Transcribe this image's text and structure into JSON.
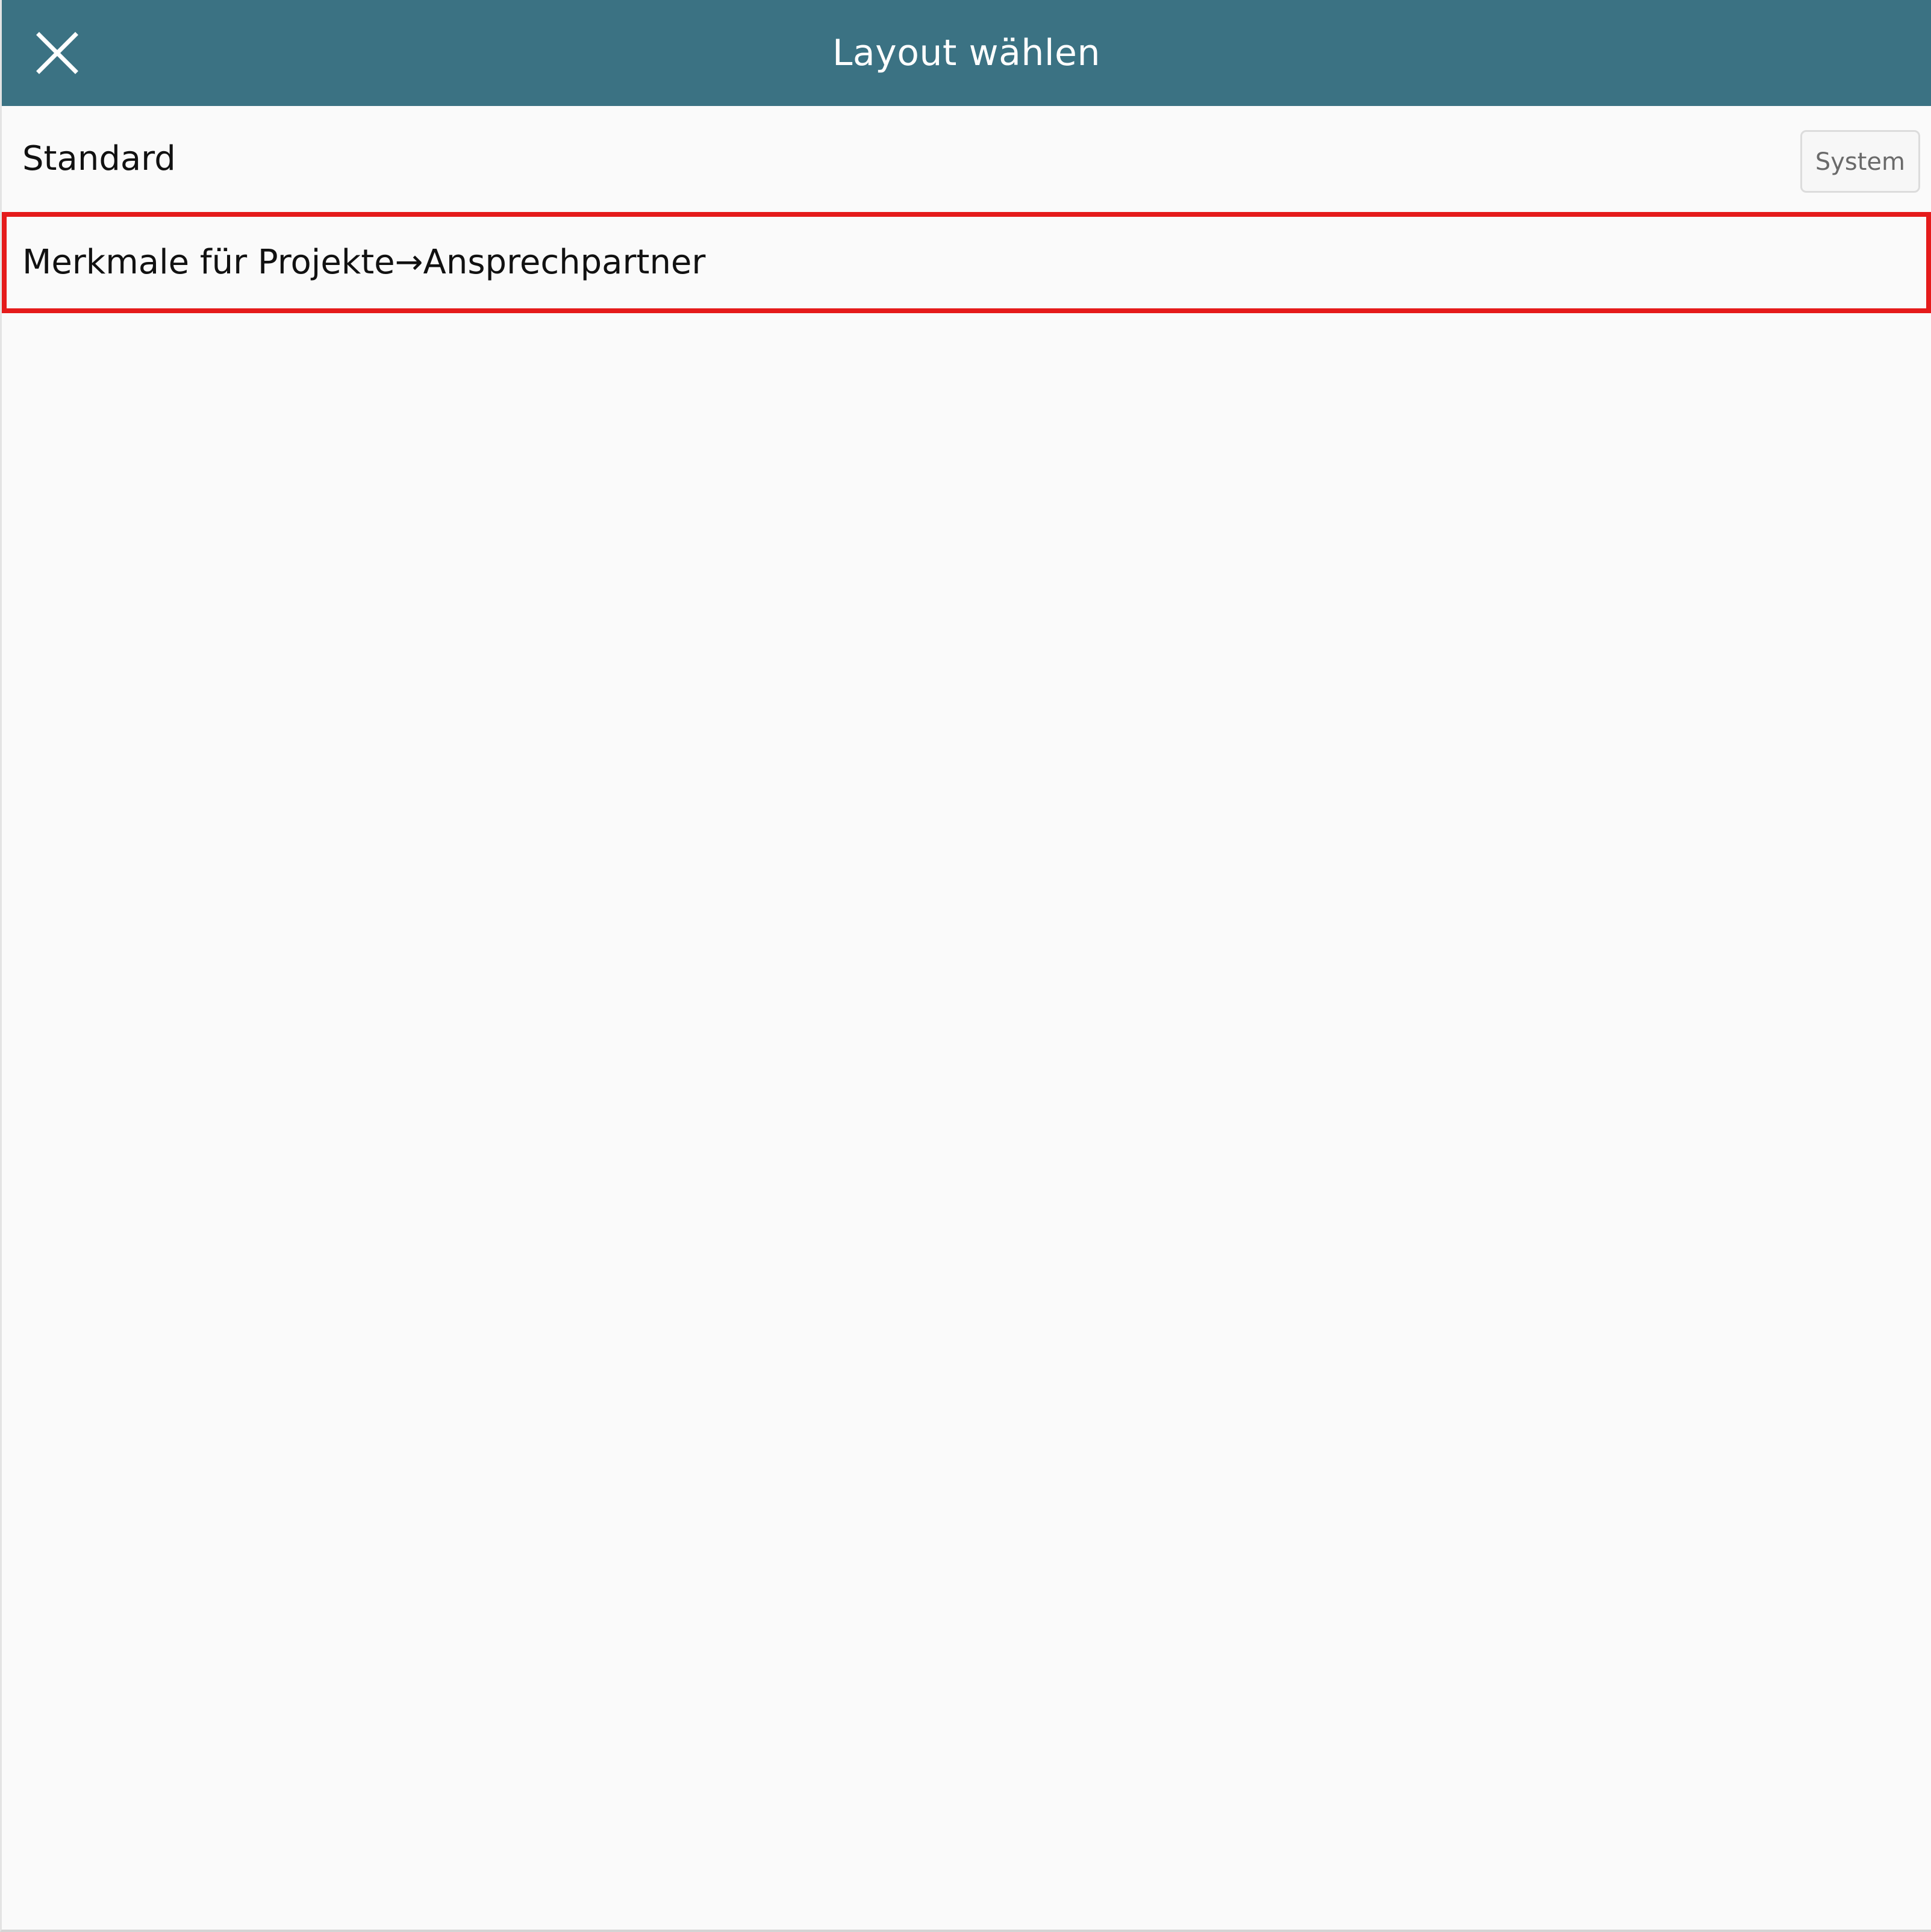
{
  "dialog": {
    "title": "Layout wählen",
    "close_icon": "close-icon",
    "header_color": "#3b7283"
  },
  "layouts": [
    {
      "label": "Standard",
      "badge": "System",
      "selected": false
    },
    {
      "label": "Merkmale für Projekte→Ansprechpartner",
      "badge": "",
      "selected": true
    }
  ],
  "highlight_color": "#e51b1b"
}
